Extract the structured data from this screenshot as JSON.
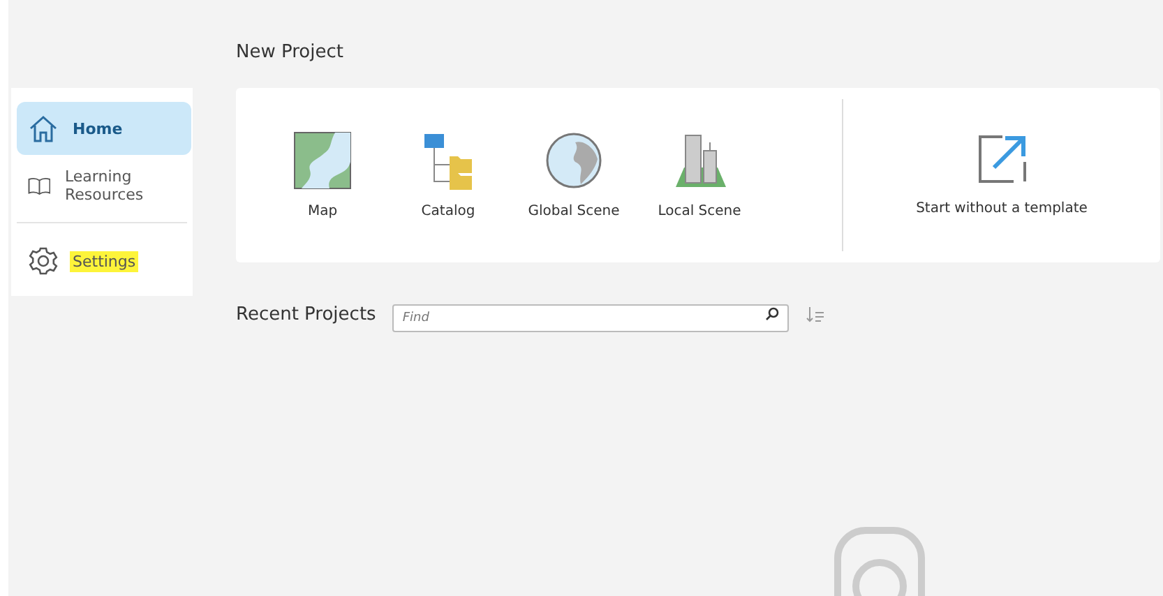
{
  "sidebar": {
    "items": [
      {
        "label": "Home",
        "kind": "home",
        "selected": true,
        "highlighted": false
      },
      {
        "label": "Learning Resources",
        "kind": "book",
        "selected": false,
        "highlighted": false
      },
      {
        "label": "Settings",
        "kind": "gear",
        "selected": false,
        "highlighted": true
      }
    ]
  },
  "new_project": {
    "title": "New Project",
    "templates": [
      {
        "label": "Map",
        "kind": "map"
      },
      {
        "label": "Catalog",
        "kind": "catalog"
      },
      {
        "label": "Global Scene",
        "kind": "globe"
      },
      {
        "label": "Local Scene",
        "kind": "local"
      }
    ],
    "blank": {
      "label": "Start without a template"
    }
  },
  "recent": {
    "title": "Recent Projects",
    "search": {
      "placeholder": "Find"
    }
  }
}
